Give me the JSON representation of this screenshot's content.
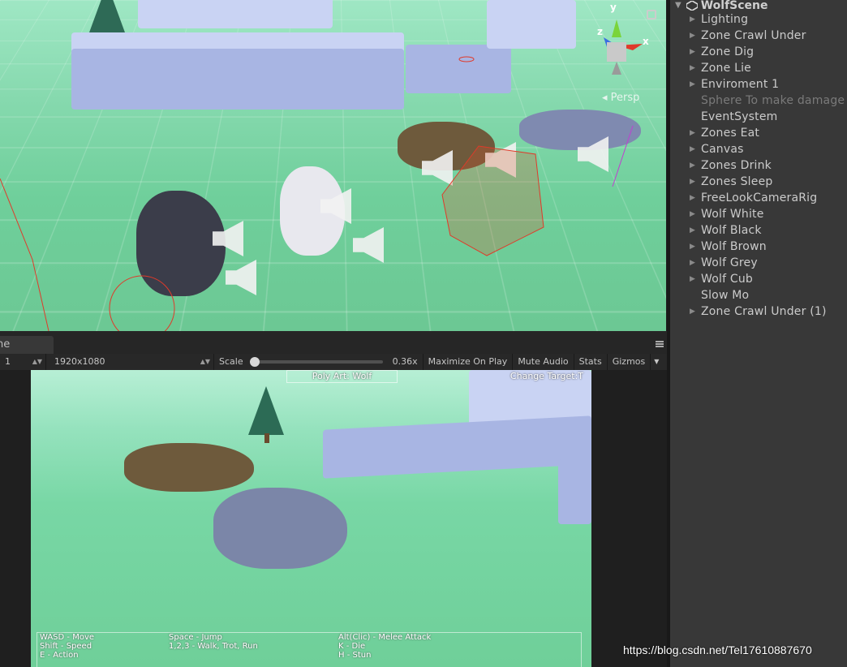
{
  "hierarchy": {
    "scene_name": "WolfScene",
    "items": [
      {
        "label": "Lighting",
        "expandable": true,
        "dim": false
      },
      {
        "label": "Zone Crawl Under",
        "expandable": true,
        "dim": false
      },
      {
        "label": "Zone Dig",
        "expandable": true,
        "dim": false
      },
      {
        "label": "Zone Lie",
        "expandable": true,
        "dim": false
      },
      {
        "label": "Enviroment 1",
        "expandable": true,
        "dim": false
      },
      {
        "label": "Sphere To make damage",
        "expandable": false,
        "dim": true
      },
      {
        "label": "EventSystem",
        "expandable": false,
        "dim": false
      },
      {
        "label": "Zones Eat",
        "expandable": true,
        "dim": false
      },
      {
        "label": "Canvas",
        "expandable": true,
        "dim": false
      },
      {
        "label": "Zones Drink",
        "expandable": true,
        "dim": false
      },
      {
        "label": "Zones Sleep",
        "expandable": true,
        "dim": false
      },
      {
        "label": "FreeLookCameraRig",
        "expandable": true,
        "dim": false
      },
      {
        "label": "Wolf White",
        "expandable": true,
        "dim": false
      },
      {
        "label": "Wolf Black",
        "expandable": true,
        "dim": false
      },
      {
        "label": "Wolf Brown",
        "expandable": true,
        "dim": false
      },
      {
        "label": "Wolf Grey",
        "expandable": true,
        "dim": false
      },
      {
        "label": "Wolf Cub",
        "expandable": true,
        "dim": false
      },
      {
        "label": "Slow Mo",
        "expandable": false,
        "dim": false
      },
      {
        "label": "Zone Crawl Under (1)",
        "expandable": true,
        "dim": false
      }
    ]
  },
  "scene_view": {
    "persp_label": "Persp",
    "gizmo": {
      "y": "y",
      "z": "z",
      "x": "x"
    }
  },
  "game_tab": {
    "label": "ne"
  },
  "toolbar": {
    "display": "1",
    "resolution": "1920x1080",
    "scale_label": "Scale",
    "scale_value": "0.36x",
    "scale_fraction": 0.0,
    "maximize_on_play": "Maximize On Play",
    "mute_audio": "Mute Audio",
    "stats": "Stats",
    "gizmos": "Gizmos"
  },
  "game_view": {
    "title": "Poly Art: Wolf",
    "change_target": "Change Target:T",
    "controls": {
      "col1": [
        "WASD - Move",
        "Shift - Speed",
        "E - Action"
      ],
      "col2": [
        "Space - Jump",
        "1,2,3 - Walk, Trot, Run"
      ],
      "col3": [
        "Alt(Clic) - Melee Attack",
        "K - Die",
        "H - Stun"
      ]
    }
  },
  "watermark": "https://blog.csdn.net/Tel17610887670",
  "colors": {
    "accent_red": "#e03a2a",
    "hierarchy_bg": "#383838"
  }
}
